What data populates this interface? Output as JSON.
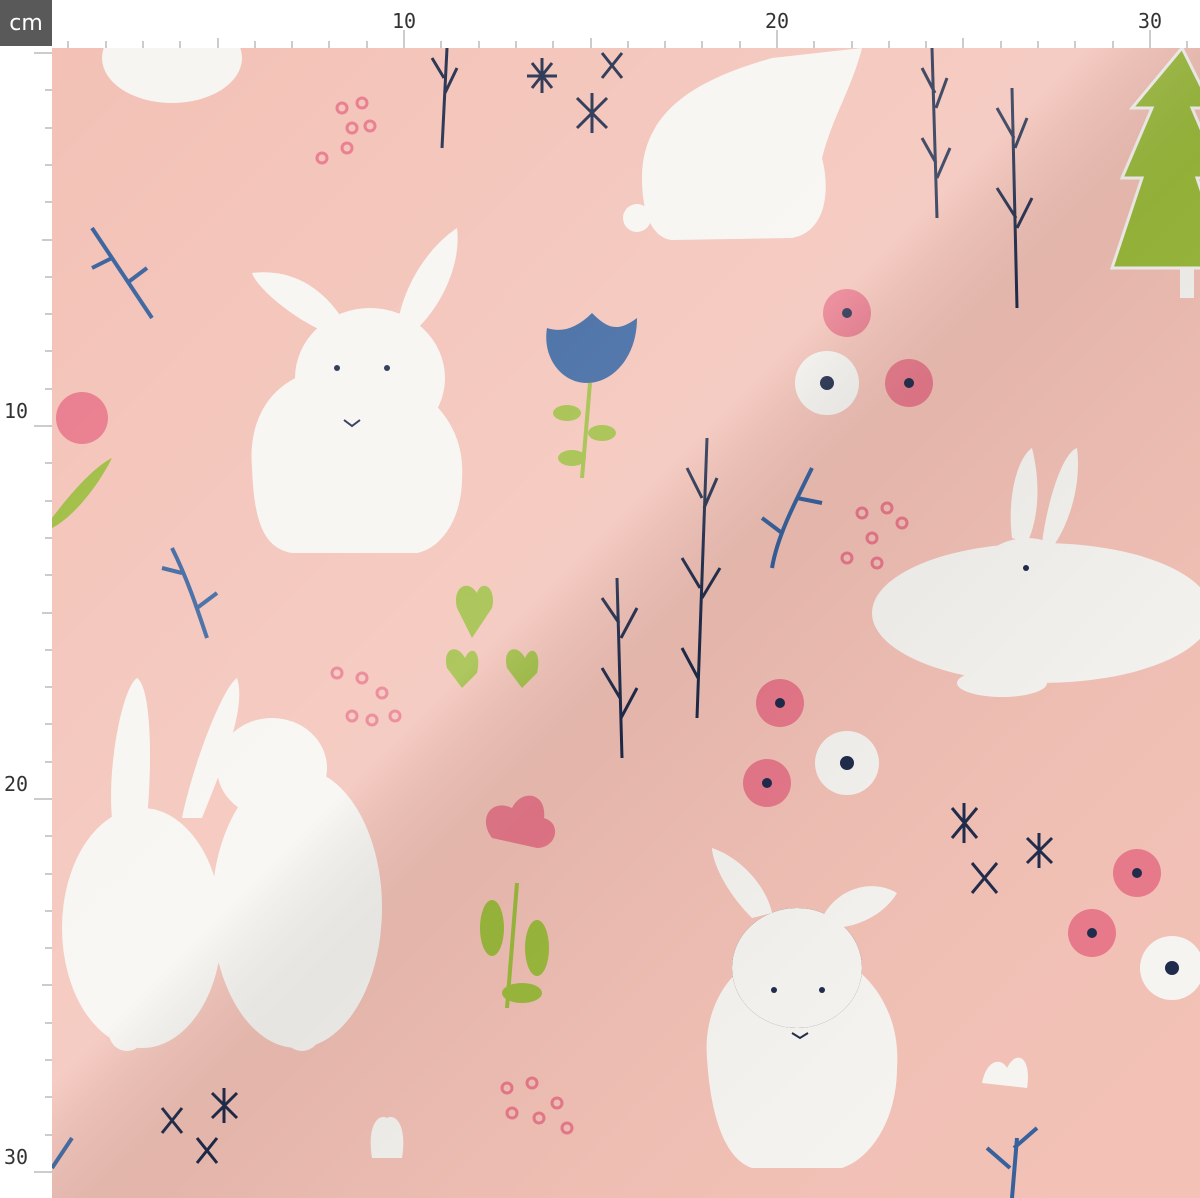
{
  "ruler": {
    "unit_label": "cm",
    "top_labels": [
      "10",
      "20",
      "30"
    ],
    "left_labels": [
      "10",
      "20",
      "30"
    ]
  },
  "pattern": {
    "background_color": "#f3c1b6",
    "bunny_color": "#f7f5f1",
    "pink_flower_color": "#e8788a",
    "navy_color": "#1e2a4a",
    "blue_color": "#35609c",
    "green_color": "#9cbb3c"
  }
}
